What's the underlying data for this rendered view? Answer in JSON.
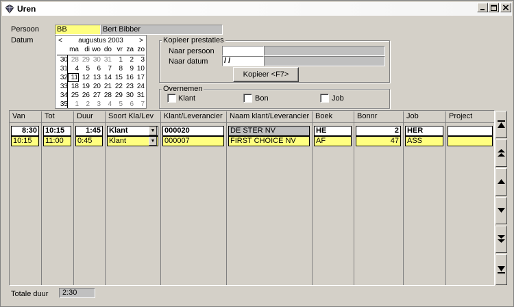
{
  "window": {
    "title": "Uren"
  },
  "form": {
    "persoon_label": "Persoon",
    "persoon_code": "BB",
    "persoon_name": "Bert Bibber",
    "datum_label": "Datum",
    "totale_duur_label": "Totale duur",
    "totale_duur_value": "2:30"
  },
  "calendar": {
    "month_label": "augustus 2003",
    "prev": "<",
    "next": ">",
    "weekdays": [
      "ma",
      "di",
      "wo",
      "do",
      "vr",
      "za",
      "zo"
    ],
    "weeks": [
      {
        "wk": "30",
        "days": [
          "28",
          "29",
          "30",
          "31",
          "1",
          "2",
          "3"
        ],
        "other": [
          true,
          true,
          true,
          true,
          false,
          false,
          false
        ]
      },
      {
        "wk": "31",
        "days": [
          "4",
          "5",
          "6",
          "7",
          "8",
          "9",
          "10"
        ],
        "other": [
          false,
          false,
          false,
          false,
          false,
          false,
          false
        ]
      },
      {
        "wk": "32",
        "days": [
          "11",
          "12",
          "13",
          "14",
          "15",
          "16",
          "17"
        ],
        "other": [
          false,
          false,
          false,
          false,
          false,
          false,
          false
        ]
      },
      {
        "wk": "33",
        "days": [
          "18",
          "19",
          "20",
          "21",
          "22",
          "23",
          "24"
        ],
        "other": [
          false,
          false,
          false,
          false,
          false,
          false,
          false
        ]
      },
      {
        "wk": "34",
        "days": [
          "25",
          "26",
          "27",
          "28",
          "29",
          "30",
          "31"
        ],
        "other": [
          false,
          false,
          false,
          false,
          false,
          false,
          false
        ]
      },
      {
        "wk": "35",
        "days": [
          "1",
          "2",
          "3",
          "4",
          "5",
          "6",
          "7"
        ],
        "other": [
          true,
          true,
          true,
          true,
          true,
          true,
          true
        ]
      }
    ],
    "selected": "11"
  },
  "kopieer": {
    "group_title": "Kopieer prestaties",
    "naar_persoon_label": "Naar persoon",
    "naar_persoon_value": "",
    "naar_datum_label": "Naar datum",
    "naar_datum_value": " /  /",
    "button_label": "Kopieer <F7>"
  },
  "overnemen": {
    "group_title": "Overnemen",
    "klant_label": "Klant",
    "bon_label": "Bon",
    "job_label": "Job"
  },
  "grid": {
    "columns": [
      "Van",
      "Tot",
      "Duur",
      "Soort Kla/Lev",
      "Klant/Leverancier",
      "Naam klant/Leverancier",
      "Boek",
      "Bonnr",
      "Job",
      "Project"
    ],
    "rows": [
      {
        "van": "8:30",
        "tot": "10:15",
        "duur": "1:45",
        "soort": "Klant",
        "klant": "000020",
        "naam": "DE STER NV",
        "boek": "HE",
        "bonnr": "2",
        "job": "HER",
        "project": ""
      },
      {
        "van": "10:15",
        "tot": "11:00",
        "duur": "0:45",
        "soort": "Klant",
        "klant": "000007",
        "naam": "FIRST CHOICE NV",
        "boek": "AF",
        "bonnr": "47",
        "job": "ASS",
        "project": ""
      }
    ]
  }
}
